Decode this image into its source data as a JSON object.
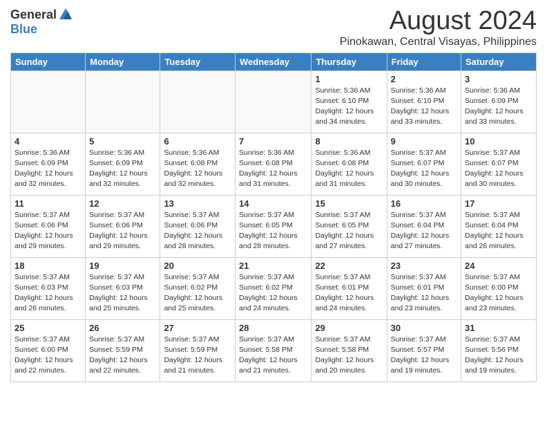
{
  "header": {
    "logo_general": "General",
    "logo_blue": "Blue",
    "month_title": "August 2024",
    "location": "Pinokawan, Central Visayas, Philippines"
  },
  "weekdays": [
    "Sunday",
    "Monday",
    "Tuesday",
    "Wednesday",
    "Thursday",
    "Friday",
    "Saturday"
  ],
  "weeks": [
    [
      {
        "day": "",
        "info": ""
      },
      {
        "day": "",
        "info": ""
      },
      {
        "day": "",
        "info": ""
      },
      {
        "day": "",
        "info": ""
      },
      {
        "day": "1",
        "info": "Sunrise: 5:36 AM\nSunset: 6:10 PM\nDaylight: 12 hours\nand 34 minutes."
      },
      {
        "day": "2",
        "info": "Sunrise: 5:36 AM\nSunset: 6:10 PM\nDaylight: 12 hours\nand 33 minutes."
      },
      {
        "day": "3",
        "info": "Sunrise: 5:36 AM\nSunset: 6:09 PM\nDaylight: 12 hours\nand 33 minutes."
      }
    ],
    [
      {
        "day": "4",
        "info": "Sunrise: 5:36 AM\nSunset: 6:09 PM\nDaylight: 12 hours\nand 32 minutes."
      },
      {
        "day": "5",
        "info": "Sunrise: 5:36 AM\nSunset: 6:09 PM\nDaylight: 12 hours\nand 32 minutes."
      },
      {
        "day": "6",
        "info": "Sunrise: 5:36 AM\nSunset: 6:08 PM\nDaylight: 12 hours\nand 32 minutes."
      },
      {
        "day": "7",
        "info": "Sunrise: 5:36 AM\nSunset: 6:08 PM\nDaylight: 12 hours\nand 31 minutes."
      },
      {
        "day": "8",
        "info": "Sunrise: 5:36 AM\nSunset: 6:08 PM\nDaylight: 12 hours\nand 31 minutes."
      },
      {
        "day": "9",
        "info": "Sunrise: 5:37 AM\nSunset: 6:07 PM\nDaylight: 12 hours\nand 30 minutes."
      },
      {
        "day": "10",
        "info": "Sunrise: 5:37 AM\nSunset: 6:07 PM\nDaylight: 12 hours\nand 30 minutes."
      }
    ],
    [
      {
        "day": "11",
        "info": "Sunrise: 5:37 AM\nSunset: 6:06 PM\nDaylight: 12 hours\nand 29 minutes."
      },
      {
        "day": "12",
        "info": "Sunrise: 5:37 AM\nSunset: 6:06 PM\nDaylight: 12 hours\nand 29 minutes."
      },
      {
        "day": "13",
        "info": "Sunrise: 5:37 AM\nSunset: 6:06 PM\nDaylight: 12 hours\nand 28 minutes."
      },
      {
        "day": "14",
        "info": "Sunrise: 5:37 AM\nSunset: 6:05 PM\nDaylight: 12 hours\nand 28 minutes."
      },
      {
        "day": "15",
        "info": "Sunrise: 5:37 AM\nSunset: 6:05 PM\nDaylight: 12 hours\nand 27 minutes."
      },
      {
        "day": "16",
        "info": "Sunrise: 5:37 AM\nSunset: 6:04 PM\nDaylight: 12 hours\nand 27 minutes."
      },
      {
        "day": "17",
        "info": "Sunrise: 5:37 AM\nSunset: 6:04 PM\nDaylight: 12 hours\nand 26 minutes."
      }
    ],
    [
      {
        "day": "18",
        "info": "Sunrise: 5:37 AM\nSunset: 6:03 PM\nDaylight: 12 hours\nand 26 minutes."
      },
      {
        "day": "19",
        "info": "Sunrise: 5:37 AM\nSunset: 6:03 PM\nDaylight: 12 hours\nand 25 minutes."
      },
      {
        "day": "20",
        "info": "Sunrise: 5:37 AM\nSunset: 6:02 PM\nDaylight: 12 hours\nand 25 minutes."
      },
      {
        "day": "21",
        "info": "Sunrise: 5:37 AM\nSunset: 6:02 PM\nDaylight: 12 hours\nand 24 minutes."
      },
      {
        "day": "22",
        "info": "Sunrise: 5:37 AM\nSunset: 6:01 PM\nDaylight: 12 hours\nand 24 minutes."
      },
      {
        "day": "23",
        "info": "Sunrise: 5:37 AM\nSunset: 6:01 PM\nDaylight: 12 hours\nand 23 minutes."
      },
      {
        "day": "24",
        "info": "Sunrise: 5:37 AM\nSunset: 6:00 PM\nDaylight: 12 hours\nand 23 minutes."
      }
    ],
    [
      {
        "day": "25",
        "info": "Sunrise: 5:37 AM\nSunset: 6:00 PM\nDaylight: 12 hours\nand 22 minutes."
      },
      {
        "day": "26",
        "info": "Sunrise: 5:37 AM\nSunset: 5:59 PM\nDaylight: 12 hours\nand 22 minutes."
      },
      {
        "day": "27",
        "info": "Sunrise: 5:37 AM\nSunset: 5:59 PM\nDaylight: 12 hours\nand 21 minutes."
      },
      {
        "day": "28",
        "info": "Sunrise: 5:37 AM\nSunset: 5:58 PM\nDaylight: 12 hours\nand 21 minutes."
      },
      {
        "day": "29",
        "info": "Sunrise: 5:37 AM\nSunset: 5:58 PM\nDaylight: 12 hours\nand 20 minutes."
      },
      {
        "day": "30",
        "info": "Sunrise: 5:37 AM\nSunset: 5:57 PM\nDaylight: 12 hours\nand 19 minutes."
      },
      {
        "day": "31",
        "info": "Sunrise: 5:37 AM\nSunset: 5:56 PM\nDaylight: 12 hours\nand 19 minutes."
      }
    ]
  ]
}
